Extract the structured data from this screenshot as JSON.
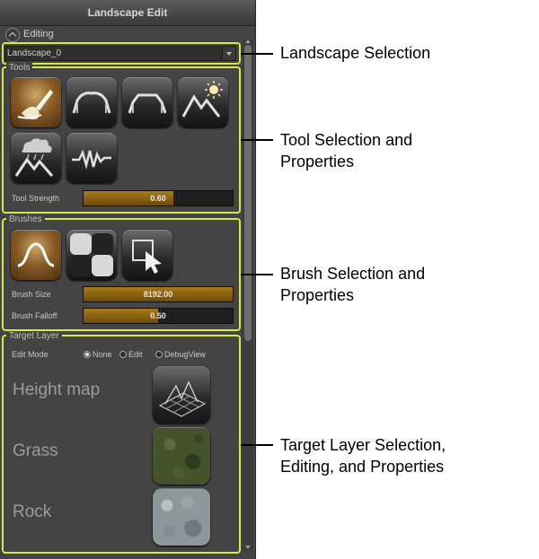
{
  "panel": {
    "title": "Landscape Edit",
    "editing_label": "Editing",
    "landscape_selected": "Landscape_0",
    "tools": {
      "group_label": "Tools",
      "buttons": [
        {
          "icon": "paint-brush-icon",
          "active": true
        },
        {
          "icon": "sculpt-icon",
          "active": false
        },
        {
          "icon": "flatten-icon",
          "active": false
        },
        {
          "icon": "erosion-sun-icon",
          "active": false
        },
        {
          "icon": "hydro-erosion-icon",
          "active": false
        },
        {
          "icon": "noise-icon",
          "active": false
        }
      ],
      "strength_label": "Tool Strength",
      "strength_value": "0.60",
      "strength_level": 0.6
    },
    "brushes": {
      "group_label": "Brushes",
      "buttons": [
        {
          "icon": "smooth-falloff-icon",
          "active": true
        },
        {
          "icon": "checker-pattern-icon",
          "active": false
        },
        {
          "icon": "component-select-icon",
          "active": false
        }
      ],
      "size_label": "Brush Size",
      "size_value": "8192.00",
      "size_level": 1.0,
      "falloff_label": "Brush Falloff",
      "falloff_value": "0.50",
      "falloff_level": 0.5
    },
    "target_layer": {
      "group_label": "Target Layer",
      "edit_mode_label": "Edit Mode",
      "modes": [
        "None",
        "Edit",
        "DebugView"
      ],
      "selected_mode": "None",
      "layers": [
        {
          "name": "Height map",
          "thumb": "heightmap"
        },
        {
          "name": "Grass",
          "thumb": "grass"
        },
        {
          "name": "Rock",
          "thumb": "rock"
        }
      ]
    }
  },
  "callouts": {
    "landscape_selection": "Landscape Selection",
    "tool_selection_1": "Tool Selection and",
    "tool_selection_2": "Properties",
    "brush_selection_1": "Brush Selection and",
    "brush_selection_2": "Properties",
    "target_layer_1": "Target Layer Selection,",
    "target_layer_2": "Editing, and Properties"
  },
  "colors": {
    "highlight": "#d6e84a",
    "accent": "#a97a1c",
    "panel_bg": "#444444"
  }
}
